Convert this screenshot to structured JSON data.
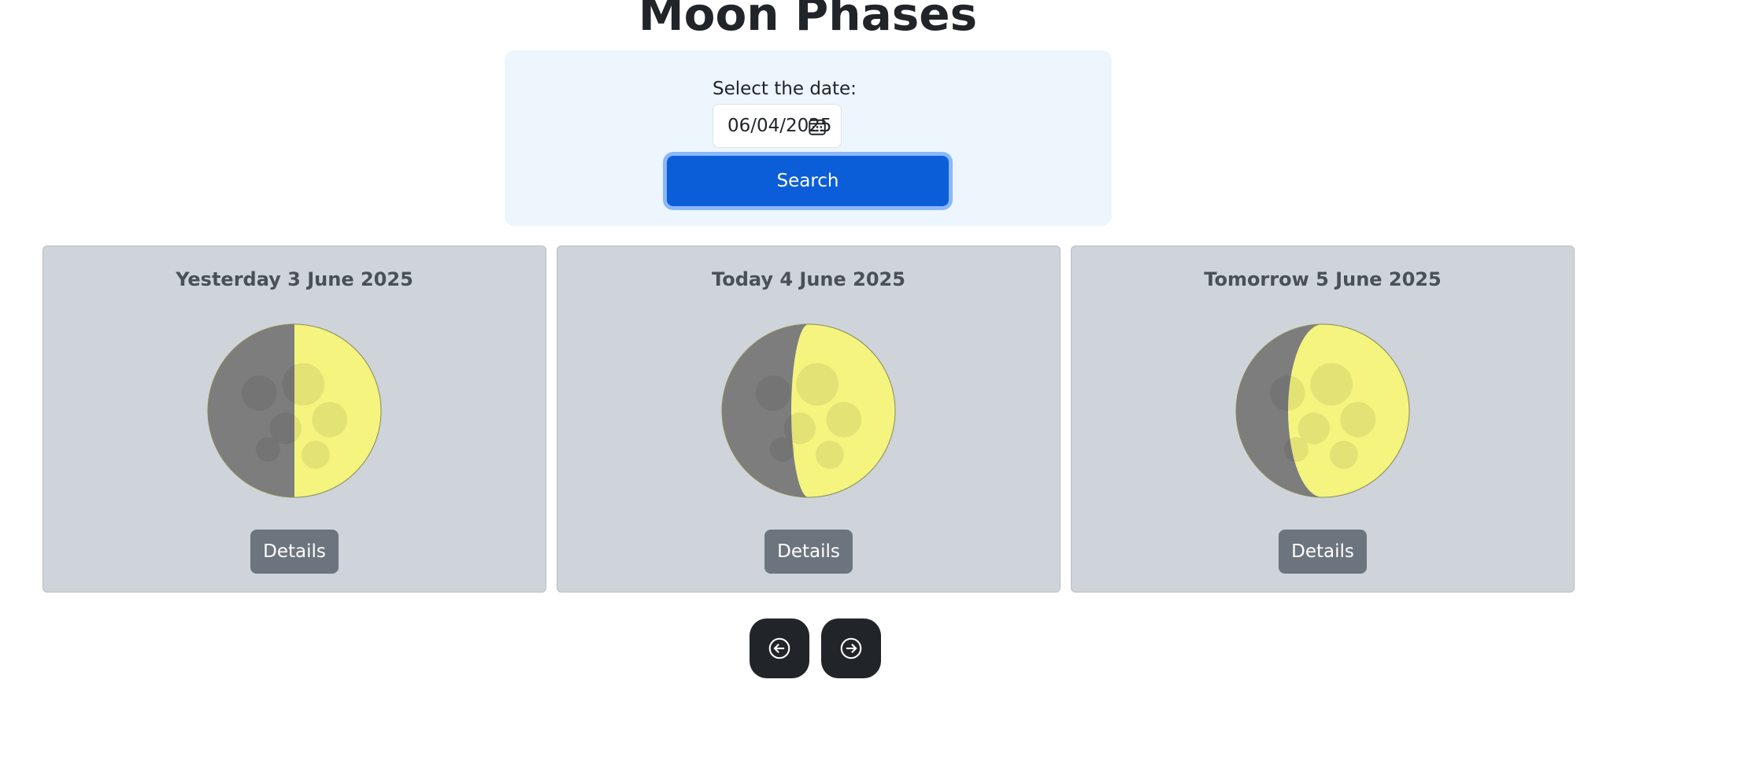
{
  "header": {
    "title": "Moon Phases"
  },
  "search": {
    "label": "Select the date:",
    "date_value": "06/04/2025",
    "button_label": "Search",
    "calendar_icon": "calendar-icon"
  },
  "cards": [
    {
      "title": "Yesterday 3 June 2025",
      "details_label": "Details",
      "illumination_fraction": 0.5
    },
    {
      "title": "Today 4 June 2025",
      "details_label": "Details",
      "illumination_fraction": 0.6
    },
    {
      "title": "Tomorrow 5 June 2025",
      "details_label": "Details",
      "illumination_fraction": 0.7
    }
  ],
  "navigation": {
    "prev_icon": "arrow-left-circle-icon",
    "next_icon": "arrow-right-circle-icon"
  },
  "colors": {
    "primary": "#0b5ed7",
    "card_background": "#ced4da",
    "moon_lit": "#f4f47e",
    "moon_dark": "#7d7d7d",
    "nav_button": "#212529"
  }
}
